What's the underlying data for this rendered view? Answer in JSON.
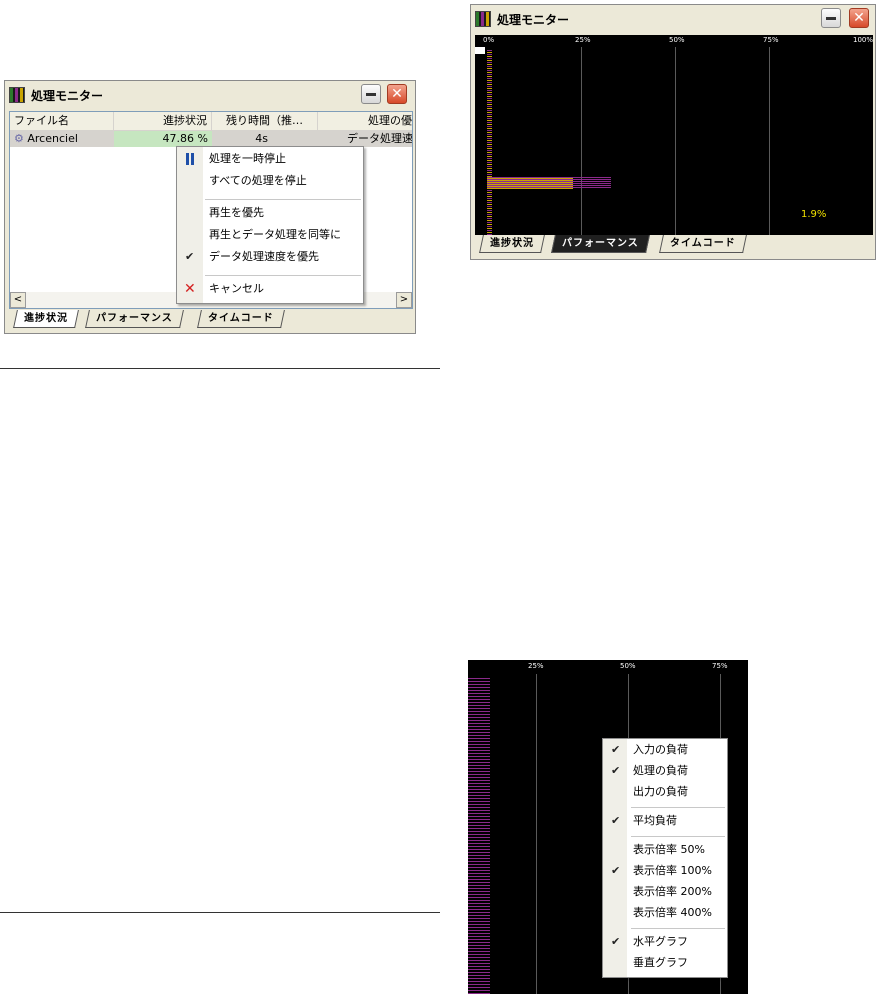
{
  "window_title": "処理モニター",
  "close_glyph": "✕",
  "scroll_left": "<",
  "scroll_right": ">",
  "list": {
    "columns": [
      "ファイル名",
      "進捗状況",
      "残り時間（推…",
      "処理の優先"
    ],
    "row": {
      "file": "Arcenciel",
      "progress": "47.86 %",
      "progress_value": 47.86,
      "remaining": "4s",
      "priority": "データ処理速度"
    }
  },
  "context_menu": {
    "items": [
      {
        "label": "処理を一時停止",
        "icon": "pause-icon"
      },
      {
        "label": "すべての処理を停止"
      },
      {
        "label": "再生を優先"
      },
      {
        "label": "再生とデータ処理を同等に"
      },
      {
        "label": "データ処理速度を優先",
        "checked": true
      },
      {
        "label": "キャンセル",
        "icon": "cancel-icon"
      }
    ],
    "check_glyph": "✔",
    "cancel_glyph": "✕"
  },
  "tabs": [
    "進捗状況",
    "パフォーマンス",
    "タイムコード"
  ],
  "performance": {
    "scale_labels": [
      "0%",
      "25%",
      "50%",
      "75%",
      "100%"
    ],
    "value_label": "1.9%",
    "colors": {
      "input": "#c9a400",
      "process": "#8a2a8a",
      "output": "#2c7a2c",
      "value": "#f0e000"
    }
  },
  "zoom_panel": {
    "scale_labels": [
      "25%",
      "50%",
      "75%"
    ],
    "menu_items": [
      {
        "label": "入力の負荷",
        "checked": true
      },
      {
        "label": "処理の負荷",
        "checked": true
      },
      {
        "label": "出力の負荷",
        "checked": false
      },
      {
        "label": "平均負荷",
        "checked": true
      },
      {
        "label": "表示倍率 50%",
        "checked": false
      },
      {
        "label": "表示倍率 100%",
        "checked": true
      },
      {
        "label": "表示倍率 200%",
        "checked": false
      },
      {
        "label": "表示倍率 400%",
        "checked": false
      },
      {
        "label": "水平グラフ",
        "checked": true
      },
      {
        "label": "垂直グラフ",
        "checked": false
      }
    ]
  }
}
